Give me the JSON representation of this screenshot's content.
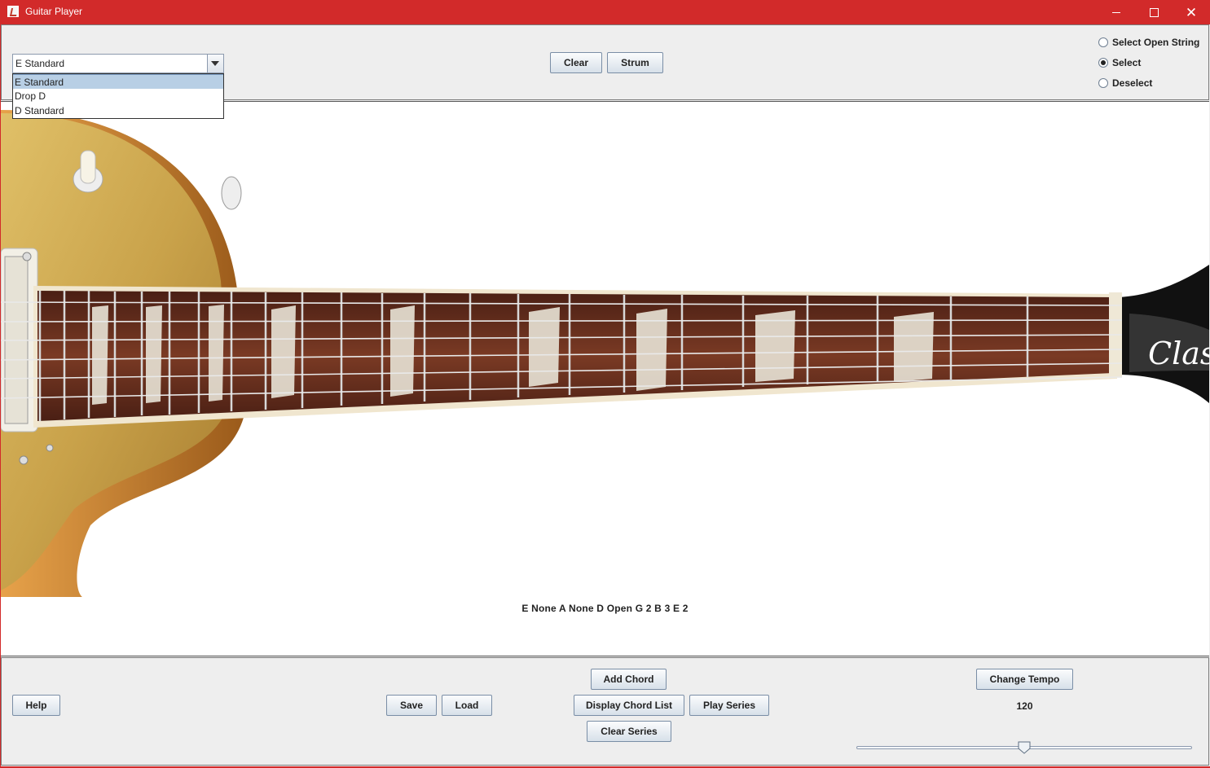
{
  "window": {
    "title": "Guitar Player",
    "accent_color": "#d22a2a"
  },
  "tuning": {
    "selected": "E Standard",
    "options": [
      "E Standard",
      "Drop D",
      "D Standard"
    ]
  },
  "top_buttons": {
    "clear": "Clear",
    "strum": "Strum"
  },
  "mode": {
    "options": [
      "Select Open String",
      "Select",
      "Deselect"
    ],
    "selected": "Select"
  },
  "chord_readout": "E None A None D Open G 2 B 3 E 2",
  "bottom_buttons": {
    "help": "Help",
    "save": "Save",
    "load": "Load",
    "add_chord": "Add Chord",
    "display_chord_list": "Display Chord List",
    "play_series": "Play Series",
    "clear_series": "Clear Series",
    "change_tempo": "Change Tempo"
  },
  "tempo": {
    "value": "120",
    "slider_fraction": 0.5
  },
  "guitar": {
    "headstock_text": "Class",
    "body_color": "#c9a24a",
    "fretboard_color": "#6b2e1e"
  }
}
